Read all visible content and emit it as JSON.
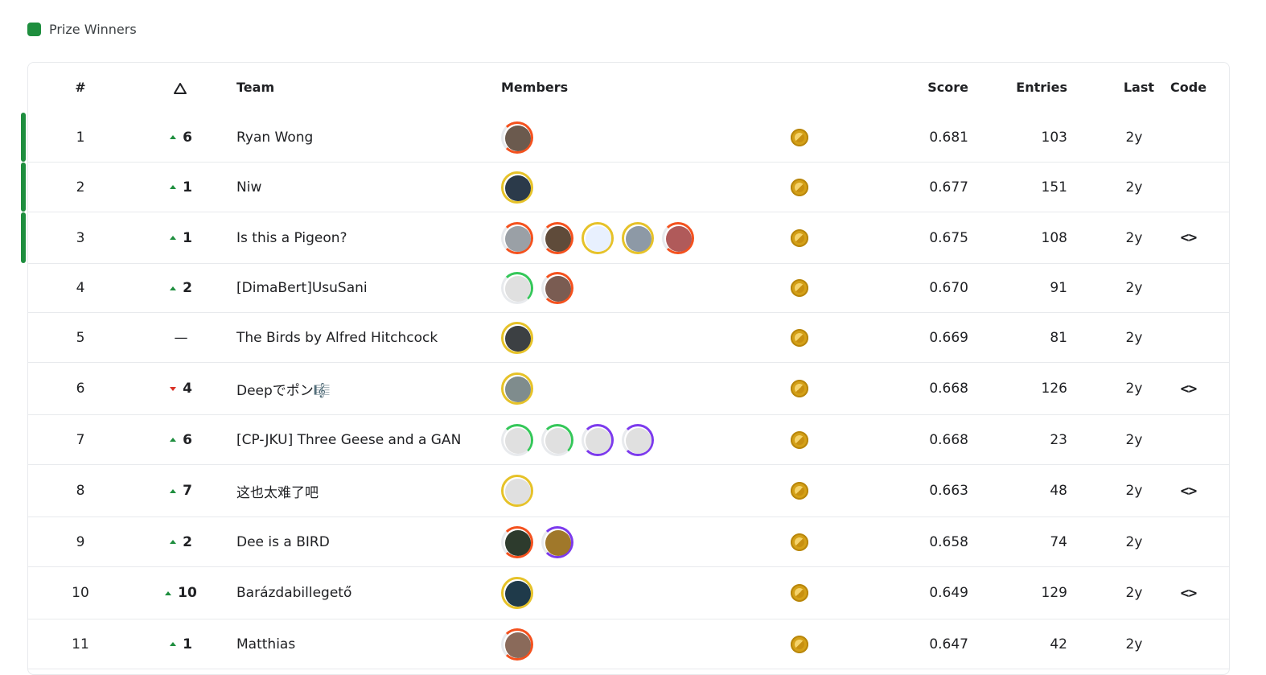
{
  "legend": {
    "label": "Prize Winners",
    "color": "#1e8e3e"
  },
  "header": {
    "rank": "#",
    "delta_icon": "delta-triangle-icon",
    "team": "Team",
    "members": "Members",
    "score": "Score",
    "entries": "Entries",
    "last": "Last",
    "code": "Code"
  },
  "rows": [
    {
      "rank": "1",
      "delta": "6",
      "dir": "up",
      "team": "Ryan Wong",
      "score": "0.681",
      "entries": "103",
      "last": "2y",
      "code": false,
      "prize": true,
      "members": [
        {
          "ring": "orange",
          "fill": "#6b5a4e"
        }
      ]
    },
    {
      "rank": "2",
      "delta": "1",
      "dir": "up",
      "team": "Niw",
      "score": "0.677",
      "entries": "151",
      "last": "2y",
      "code": false,
      "prize": true,
      "members": [
        {
          "ring": "gold",
          "fill": "#2b3a4a"
        }
      ]
    },
    {
      "rank": "3",
      "delta": "1",
      "dir": "up",
      "team": "Is this a Pigeon?",
      "score": "0.675",
      "entries": "108",
      "last": "2y",
      "code": true,
      "prize": true,
      "members": [
        {
          "ring": "orange",
          "fill": "#9aa0a6"
        },
        {
          "ring": "orange",
          "fill": "#5f4b3a"
        },
        {
          "ring": "gold",
          "fill": "#e8f0fe"
        },
        {
          "ring": "gold",
          "fill": "#8d99a6"
        },
        {
          "ring": "orange",
          "fill": "#b05a5a"
        }
      ]
    },
    {
      "rank": "4",
      "delta": "2",
      "dir": "up",
      "team": "[DimaBert]UsuSani",
      "score": "0.670",
      "entries": "91",
      "last": "2y",
      "code": false,
      "prize": false,
      "members": [
        {
          "ring": "green",
          "fill": "#e0e0e0"
        },
        {
          "ring": "orange",
          "fill": "#7a5c52"
        }
      ]
    },
    {
      "rank": "5",
      "delta": "—",
      "dir": "same",
      "team": "The Birds by Alfred Hitchcock",
      "score": "0.669",
      "entries": "81",
      "last": "2y",
      "code": false,
      "prize": false,
      "members": [
        {
          "ring": "gold",
          "fill": "#3c4043"
        }
      ]
    },
    {
      "rank": "6",
      "delta": "4",
      "dir": "down",
      "team": "Deepでポン🎼",
      "score": "0.668",
      "entries": "126",
      "last": "2y",
      "code": true,
      "prize": false,
      "members": [
        {
          "ring": "gold",
          "fill": "#7f8c8d"
        }
      ]
    },
    {
      "rank": "7",
      "delta": "6",
      "dir": "up",
      "team": "[CP-JKU] Three Geese and a GAN",
      "score": "0.668",
      "entries": "23",
      "last": "2y",
      "code": false,
      "prize": false,
      "members": [
        {
          "ring": "green",
          "fill": "#e0e0e0"
        },
        {
          "ring": "green",
          "fill": "#e0e0e0"
        },
        {
          "ring": "purple",
          "fill": "#e0e0e0"
        },
        {
          "ring": "purple",
          "fill": "#e0e0e0"
        }
      ]
    },
    {
      "rank": "8",
      "delta": "7",
      "dir": "up",
      "team": "这也太难了吧",
      "score": "0.663",
      "entries": "48",
      "last": "2y",
      "code": true,
      "prize": false,
      "members": [
        {
          "ring": "gold",
          "fill": "#e0e0e0"
        }
      ]
    },
    {
      "rank": "9",
      "delta": "2",
      "dir": "up",
      "team": "Dee is a BIRD",
      "score": "0.658",
      "entries": "74",
      "last": "2y",
      "code": false,
      "prize": false,
      "members": [
        {
          "ring": "orange",
          "fill": "#2d3b2d"
        },
        {
          "ring": "purple",
          "fill": "#a0782a"
        }
      ]
    },
    {
      "rank": "10",
      "delta": "10",
      "dir": "up",
      "team": "Barázdabillegető",
      "score": "0.649",
      "entries": "129",
      "last": "2y",
      "code": true,
      "prize": false,
      "members": [
        {
          "ring": "gold",
          "fill": "#1f3a4a"
        }
      ]
    },
    {
      "rank": "11",
      "delta": "1",
      "dir": "up",
      "team": "Matthias",
      "score": "0.647",
      "entries": "42",
      "last": "2y",
      "code": false,
      "prize": false,
      "members": [
        {
          "ring": "orange",
          "fill": "#8a6a5a"
        }
      ]
    }
  ],
  "medal_icon": "gold-medal-icon",
  "code_icon": "code-icon",
  "code_glyph": "<>",
  "ring_colors": {
    "orange": "#f4511e",
    "gold": "#e6c229",
    "green": "#34c759",
    "purple": "#7c3aed"
  }
}
